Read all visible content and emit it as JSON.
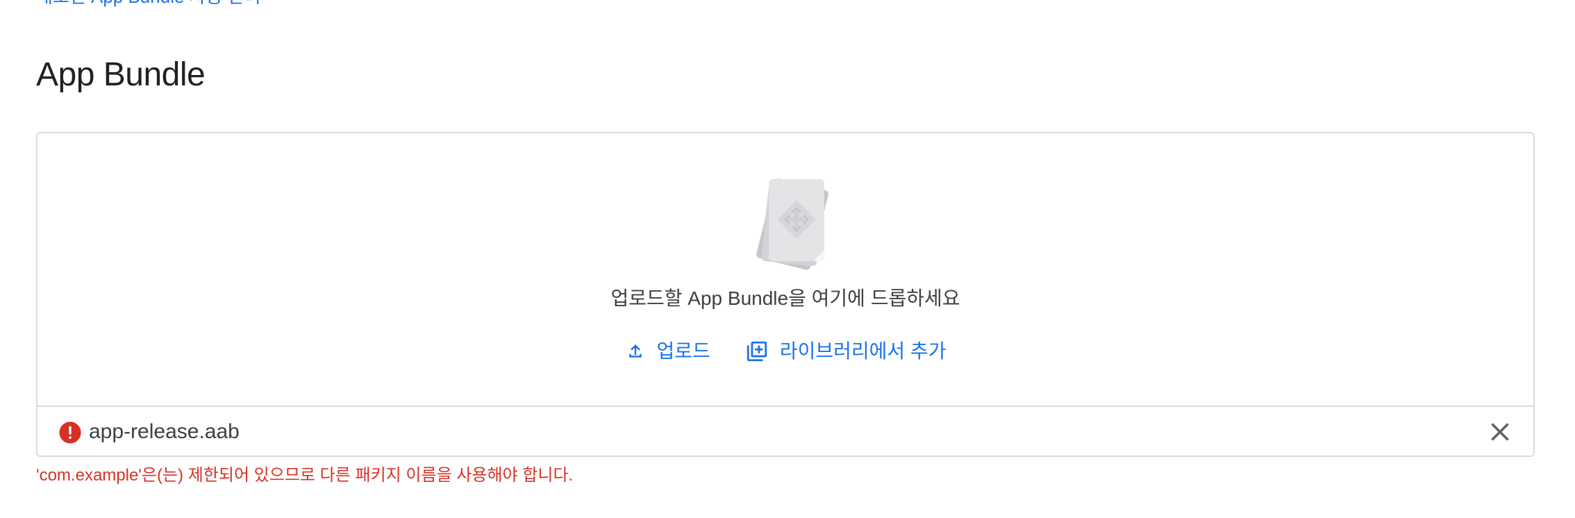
{
  "top_link": {
    "text": "배포된 App Bundle 사용 관리"
  },
  "section": {
    "title": "App Bundle"
  },
  "dropzone": {
    "illustration_icon": "app-bundle-stack-icon",
    "drop_text": "업로드할 App Bundle을 여기에 드롭하세요",
    "actions": {
      "upload_label": "업로드",
      "upload_icon": "upload-icon",
      "library_label": "라이브러리에서 추가",
      "library_icon": "library-add-icon"
    }
  },
  "file": {
    "status_icon": "error-icon",
    "name": "app-release.aab",
    "remove_icon": "close-icon"
  },
  "error": {
    "message": "'com.example'은(는) 제한되어 있으므로 다른 패키지 이름을 사용해야 합니다."
  },
  "colors": {
    "accent": "#1a73e8",
    "error": "#d93025",
    "border": "#dadce0",
    "text": "#202124"
  }
}
